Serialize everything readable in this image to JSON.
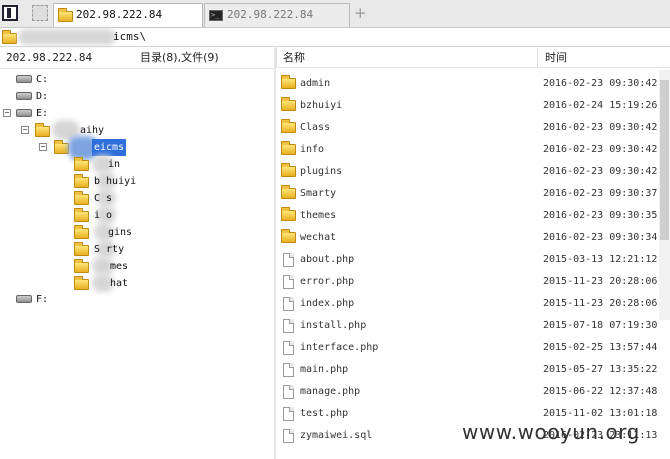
{
  "tabs": [
    {
      "label": "202.98.222.84",
      "icon": "folder-icon",
      "active": true
    },
    {
      "label": "202.98.222.84",
      "icon": "terminal-icon",
      "active": false
    }
  ],
  "new_tab_label": "+",
  "path": {
    "text": "icms\\"
  },
  "left_header": {
    "host": "202.98.222.84",
    "summary": "目录(8),文件(9)"
  },
  "columns": {
    "name": "名称",
    "time": "时间"
  },
  "tree": [
    {
      "label": "C:",
      "type": "drive"
    },
    {
      "label": "D:",
      "type": "drive"
    },
    {
      "label": "E:",
      "type": "drive",
      "toggle": "−"
    },
    {
      "label": "aihy",
      "type": "folder",
      "toggle": "−"
    },
    {
      "label": "eicms",
      "type": "folder",
      "toggle": "−",
      "selected": true
    },
    {
      "label": "in",
      "type": "folder"
    },
    {
      "label": "b huiyi",
      "type": "folder"
    },
    {
      "label": "C s",
      "type": "folder"
    },
    {
      "label": "i o",
      "type": "folder"
    },
    {
      "label": "gins",
      "type": "folder"
    },
    {
      "label": "S rty",
      "type": "folder"
    },
    {
      "label": "mes",
      "type": "folder"
    },
    {
      "label": "hat",
      "type": "folder"
    },
    {
      "label": "F:",
      "type": "drive"
    }
  ],
  "files": [
    {
      "name": "admin",
      "time": "2016-02-23 09:30:42",
      "type": "folder"
    },
    {
      "name": "bzhuiyi",
      "time": "2016-02-24 15:19:26",
      "type": "folder"
    },
    {
      "name": "Class",
      "time": "2016-02-23 09:30:42",
      "type": "folder"
    },
    {
      "name": "info",
      "time": "2016-02-23 09:30:42",
      "type": "folder"
    },
    {
      "name": "plugins",
      "time": "2016-02-23 09:30:42",
      "type": "folder"
    },
    {
      "name": "Smarty",
      "time": "2016-02-23 09:30:37",
      "type": "folder"
    },
    {
      "name": "themes",
      "time": "2016-02-23 09:30:35",
      "type": "folder"
    },
    {
      "name": "wechat",
      "time": "2016-02-23 09:30:34",
      "type": "folder"
    },
    {
      "name": "about.php",
      "time": "2015-03-13 12:21:12",
      "type": "file"
    },
    {
      "name": "error.php",
      "time": "2015-11-23 20:28:06",
      "type": "file"
    },
    {
      "name": "index.php",
      "time": "2015-11-23 20:28:06",
      "type": "file"
    },
    {
      "name": "install.php",
      "time": "2015-07-18 07:19:30",
      "type": "file"
    },
    {
      "name": "interface.php",
      "time": "2015-02-25 13:57:44",
      "type": "file"
    },
    {
      "name": "main.php",
      "time": "2015-05-27 13:35:22",
      "type": "file"
    },
    {
      "name": "manage.php",
      "time": "2015-06-22 12:37:48",
      "type": "file"
    },
    {
      "name": "test.php",
      "time": "2015-11-02 13:01:18",
      "type": "file"
    },
    {
      "name": "zymaiwei.sql",
      "time": "2016-02-23 23:11:13",
      "type": "file"
    }
  ],
  "watermark": "www.wooyun.org"
}
